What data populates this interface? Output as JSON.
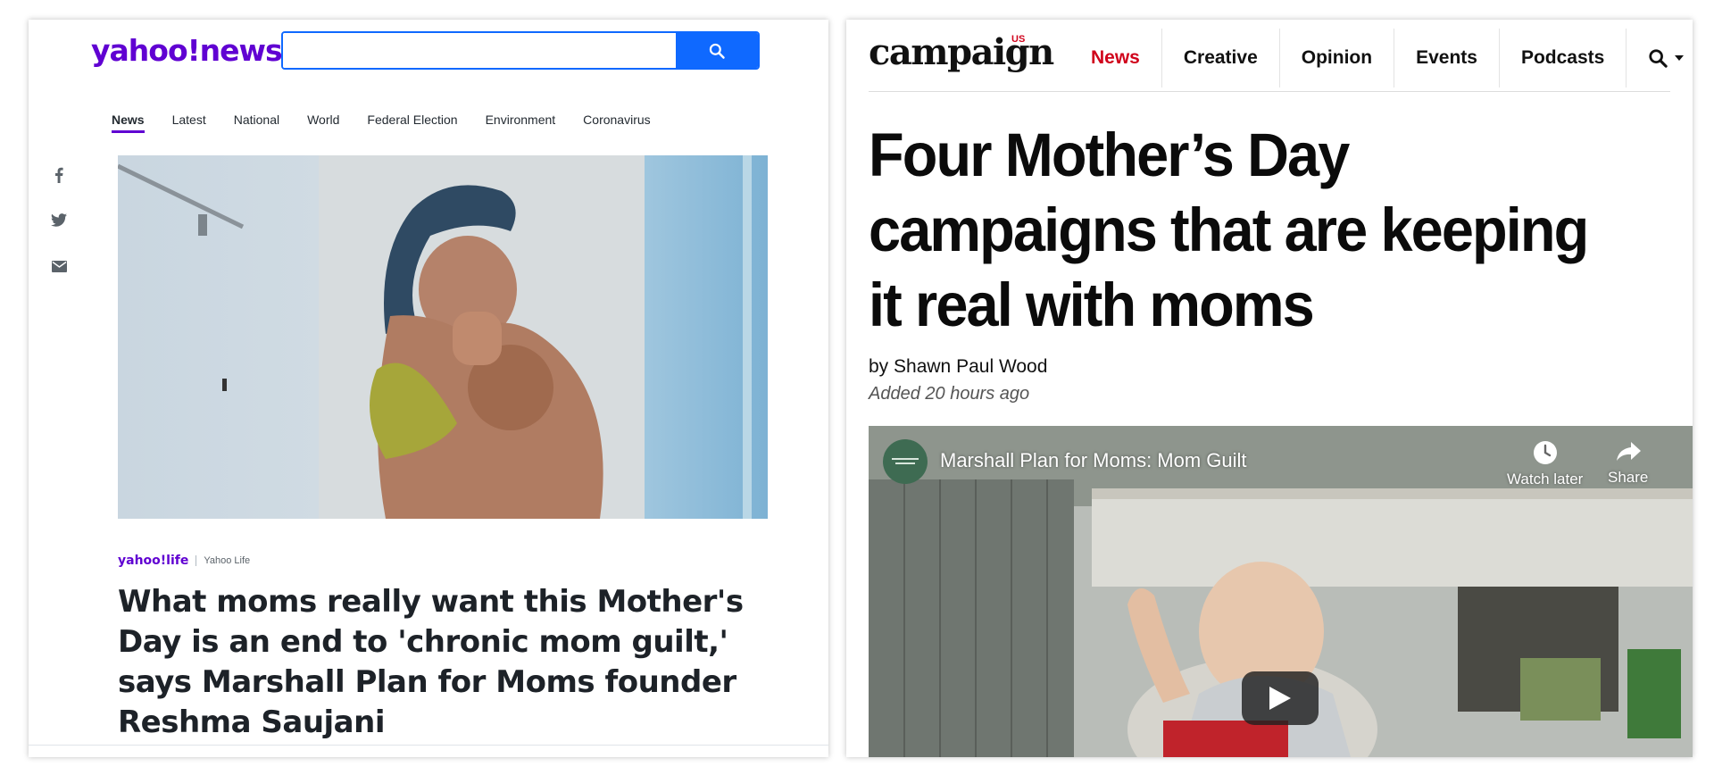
{
  "yahoo": {
    "logo": "yahoo!news",
    "search": {
      "placeholder": "",
      "value": ""
    },
    "nav": [
      "News",
      "Latest",
      "National",
      "World",
      "Federal Election",
      "Environment",
      "Coronavirus"
    ],
    "active_nav": "News",
    "share_icons": [
      "facebook-icon",
      "twitter-icon",
      "email-icon"
    ],
    "source_logo": "yahoo!life",
    "source_name": "Yahoo Life",
    "headline": "What moms really want this Mother's Day is an end to 'chronic mom guilt,' says Marshall Plan for Moms founder Reshma Saujani",
    "colors": {
      "brand": "#6001d2",
      "search": "#0f69ff",
      "text": "#1d2228"
    }
  },
  "campaign": {
    "logo": "campaign",
    "logo_region": "US",
    "nav": [
      "News",
      "Creative",
      "Opinion",
      "Events",
      "Podcasts"
    ],
    "active_nav": "News",
    "headline": "Four Mother’s Day campaigns that are keeping it real with moms",
    "byline_prefix": "by",
    "author": "Shawn Paul Wood",
    "added": "Added 20 hours ago",
    "video": {
      "title": "Marshall Plan for Moms: Mom Guilt",
      "watch_later": "Watch later",
      "share": "Share"
    },
    "colors": {
      "accent": "#d0021b",
      "text": "#0b0b0b"
    }
  }
}
